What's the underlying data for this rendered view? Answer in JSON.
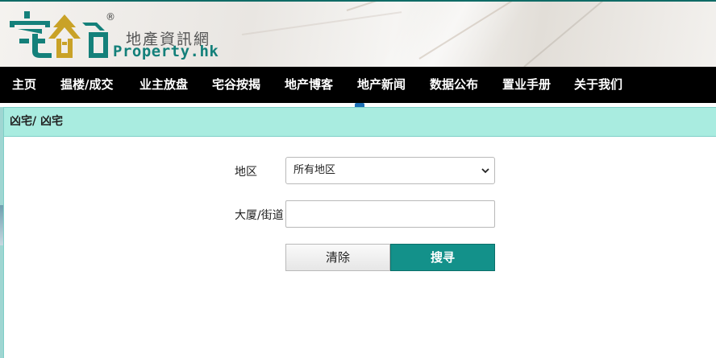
{
  "brand": {
    "name_cn": "地產資訊網",
    "name_en": "Property.hk",
    "registered_mark": "®",
    "accent_color": "#13918a",
    "nav_background": "#000000",
    "panel_header_color": "#a9ece0"
  },
  "nav": {
    "items": [
      {
        "label": "主页"
      },
      {
        "label": "揾楼/成交"
      },
      {
        "label": "业主放盘"
      },
      {
        "label": "宅谷按揭"
      },
      {
        "label": "地产博客"
      },
      {
        "label": "地产新闻"
      },
      {
        "label": "数据公布"
      },
      {
        "label": "置业手册"
      },
      {
        "label": "关于我们"
      }
    ]
  },
  "panel": {
    "title": "凶宅/ 凶宅"
  },
  "form": {
    "district_label": "地区",
    "district_value": "所有地区",
    "building_label": "大厦/街道",
    "building_value": "",
    "clear_label": "清除",
    "search_label": "搜寻"
  }
}
